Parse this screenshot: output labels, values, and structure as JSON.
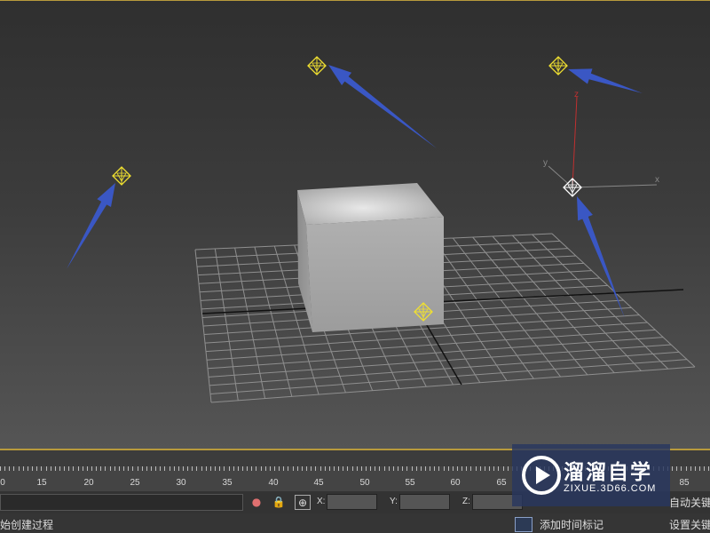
{
  "viewport": {
    "gizmo_axes": {
      "x": "x",
      "y": "y",
      "z": "z"
    }
  },
  "timeline": {
    "ruler_labels": [
      "0",
      "15",
      "20",
      "25",
      "30",
      "35",
      "40",
      "45",
      "50",
      "55",
      "60",
      "65",
      "85"
    ]
  },
  "statusbar": {
    "x_label": "X:",
    "y_label": "Y:",
    "z_label": "Z:",
    "auto_key": "自动关键",
    "set_key": "设置关键"
  },
  "bottombar": {
    "prompt": "始创建过程",
    "add_time_tag": "添加时间标记"
  },
  "watermark": {
    "title": "溜溜自学",
    "subtitle": "ZIXUE.3D66.COM"
  },
  "colors": {
    "arrow": "#3a57c4",
    "light_icon": "#f0e030",
    "grid": "#9a9a9a",
    "box": "#a8a8a8"
  }
}
